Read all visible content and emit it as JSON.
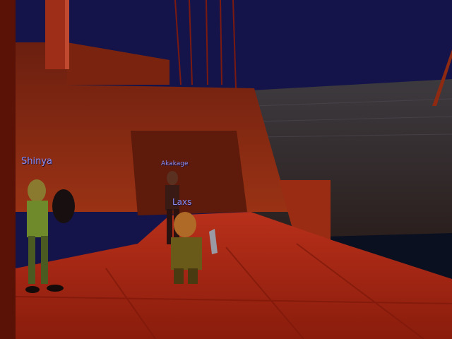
{
  "scene": {
    "type": "3d-game-view",
    "colors": {
      "sky": "#14144a",
      "ship_wood": "#8e2a12",
      "deck": "#a0230f",
      "stone_wall": "#3a2f33",
      "water": "#0a1020",
      "nameplate": "#8a8cf0"
    }
  },
  "characters": [
    {
      "name": "Shinya",
      "role": "player-character",
      "pose": "standing-with-shield"
    },
    {
      "name": "Akakage",
      "role": "player-character",
      "pose": "standing-in-doorway"
    },
    {
      "name": "Laxs",
      "role": "player-character",
      "pose": "dwarf-with-dagger"
    }
  ]
}
